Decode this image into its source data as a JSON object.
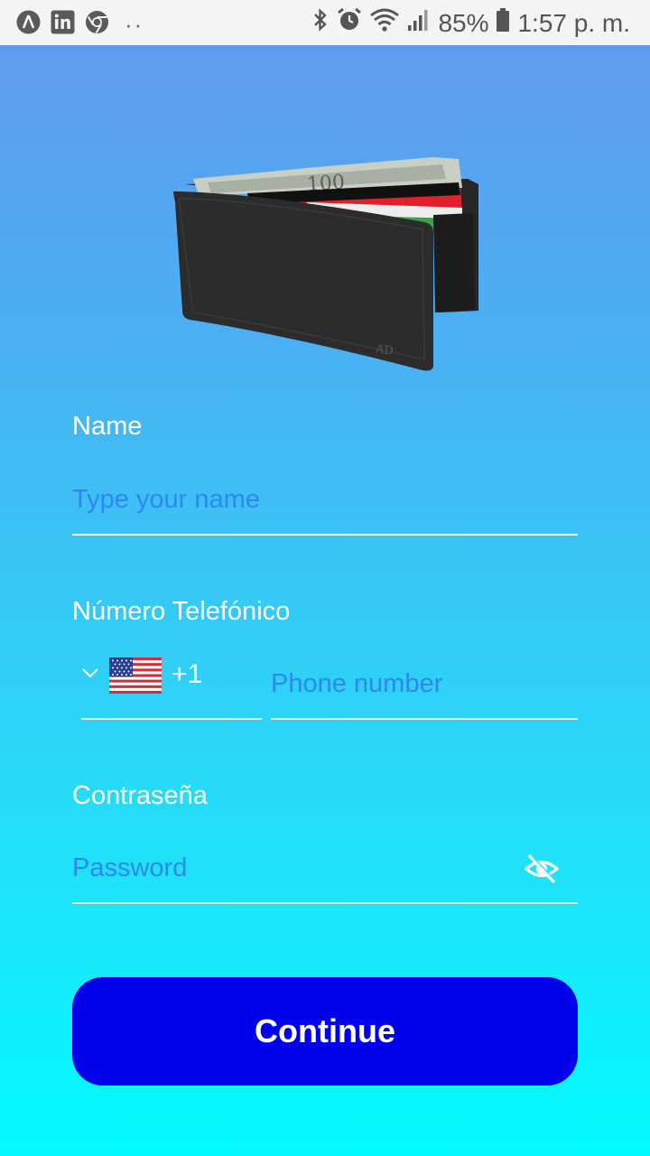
{
  "status_bar": {
    "left_icons": [
      "app-a-icon",
      "linkedin-icon",
      "chrome-icon",
      "more-notifications-icon"
    ],
    "more_dots": "··",
    "right_icons": [
      "bluetooth-icon",
      "alarm-icon",
      "wifi-icon",
      "signal-icon",
      "battery-icon"
    ],
    "battery": "85%",
    "time": "1:57 p. m."
  },
  "form": {
    "name": {
      "label": "Name",
      "placeholder": "Type your name"
    },
    "phone": {
      "label": "Número Telefónico",
      "country_flag": "us-flag-icon",
      "dial_code": "+1",
      "placeholder": "Phone number"
    },
    "password": {
      "label": "Contraseña",
      "placeholder": "Password",
      "toggle_icon": "eye-off-icon"
    }
  },
  "continue_button": {
    "label": "Continue"
  },
  "colors": {
    "gradient_top": "#6397EE",
    "gradient_bottom": "#02FBFE",
    "placeholder": "#2E86F4",
    "button": "#0000EA",
    "label": "#FFFFFF"
  }
}
